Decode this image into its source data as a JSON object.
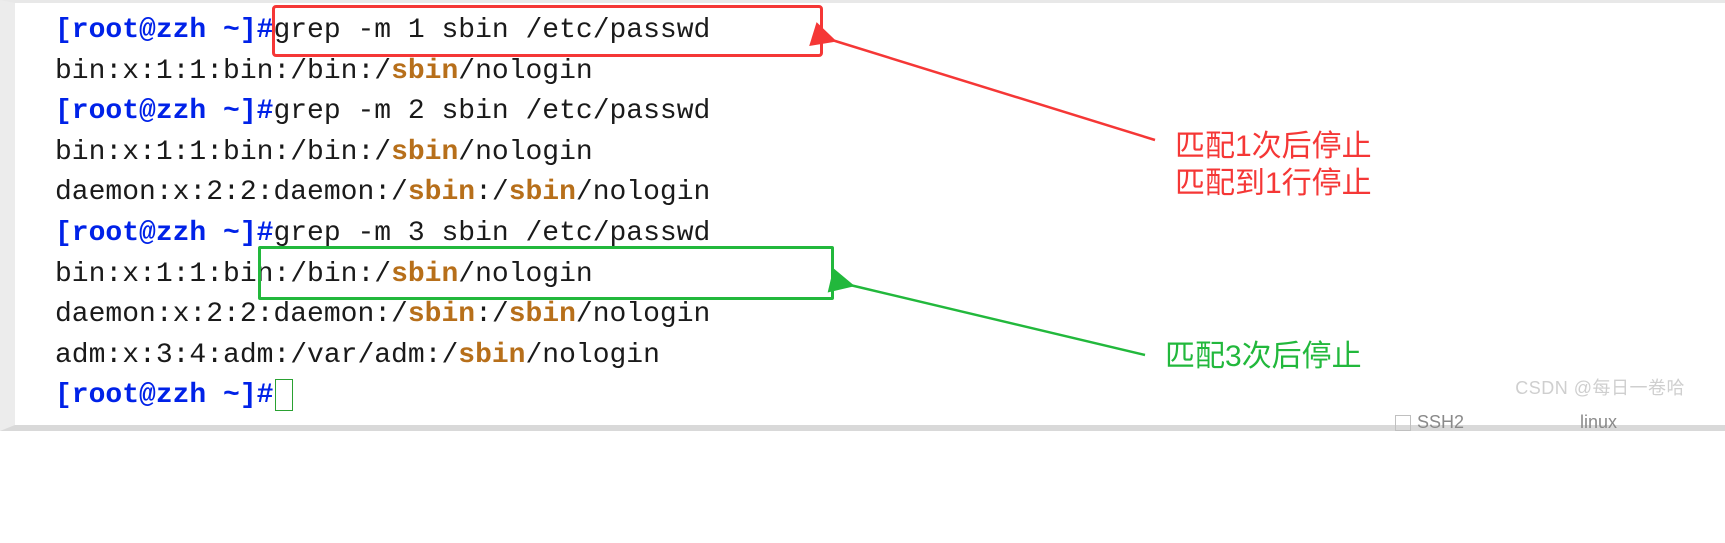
{
  "prompt": "[root@zzh ~]#",
  "lines": [
    {
      "type": "cmd",
      "text": "grep -m 1 sbin /etc/passwd"
    },
    {
      "type": "out",
      "segments": [
        {
          "t": "bin:x:1:1:bin:/bin:/",
          "h": false
        },
        {
          "t": "sbin",
          "h": true
        },
        {
          "t": "/nologin",
          "h": false
        }
      ]
    },
    {
      "type": "cmd",
      "text": "grep -m 2 sbin /etc/passwd"
    },
    {
      "type": "out",
      "segments": [
        {
          "t": "bin:x:1:1:bin:/bin:/",
          "h": false
        },
        {
          "t": "sbin",
          "h": true
        },
        {
          "t": "/nologin",
          "h": false
        }
      ]
    },
    {
      "type": "out",
      "segments": [
        {
          "t": "daemon:x:2:2:daemon:/",
          "h": false
        },
        {
          "t": "sbin",
          "h": true
        },
        {
          "t": ":/",
          "h": false
        },
        {
          "t": "sbin",
          "h": true
        },
        {
          "t": "/nologin",
          "h": false
        }
      ]
    },
    {
      "type": "cmd",
      "text": "grep -m 3 sbin /etc/passwd"
    },
    {
      "type": "out",
      "segments": [
        {
          "t": "bin:x:1:1:bin:/bin:/",
          "h": false
        },
        {
          "t": "sbin",
          "h": true
        },
        {
          "t": "/nologin",
          "h": false
        }
      ]
    },
    {
      "type": "out",
      "segments": [
        {
          "t": "daemon:x:2:2:daemon:/",
          "h": false
        },
        {
          "t": "sbin",
          "h": true
        },
        {
          "t": ":/",
          "h": false
        },
        {
          "t": "sbin",
          "h": true
        },
        {
          "t": "/nologin",
          "h": false
        }
      ]
    },
    {
      "type": "out",
      "segments": [
        {
          "t": "adm:x:3:4:adm:/var/adm:/",
          "h": false
        },
        {
          "t": "sbin",
          "h": true
        },
        {
          "t": "/nologin",
          "h": false
        }
      ]
    },
    {
      "type": "prompt_only"
    }
  ],
  "annotation_red_1": "匹配1次后停止",
  "annotation_red_2": "匹配到1行停止",
  "annotation_green": "匹配3次后停止",
  "watermark": "CSDN @每日一卷哈",
  "status": {
    "left": "SSH2",
    "right": "linux"
  }
}
